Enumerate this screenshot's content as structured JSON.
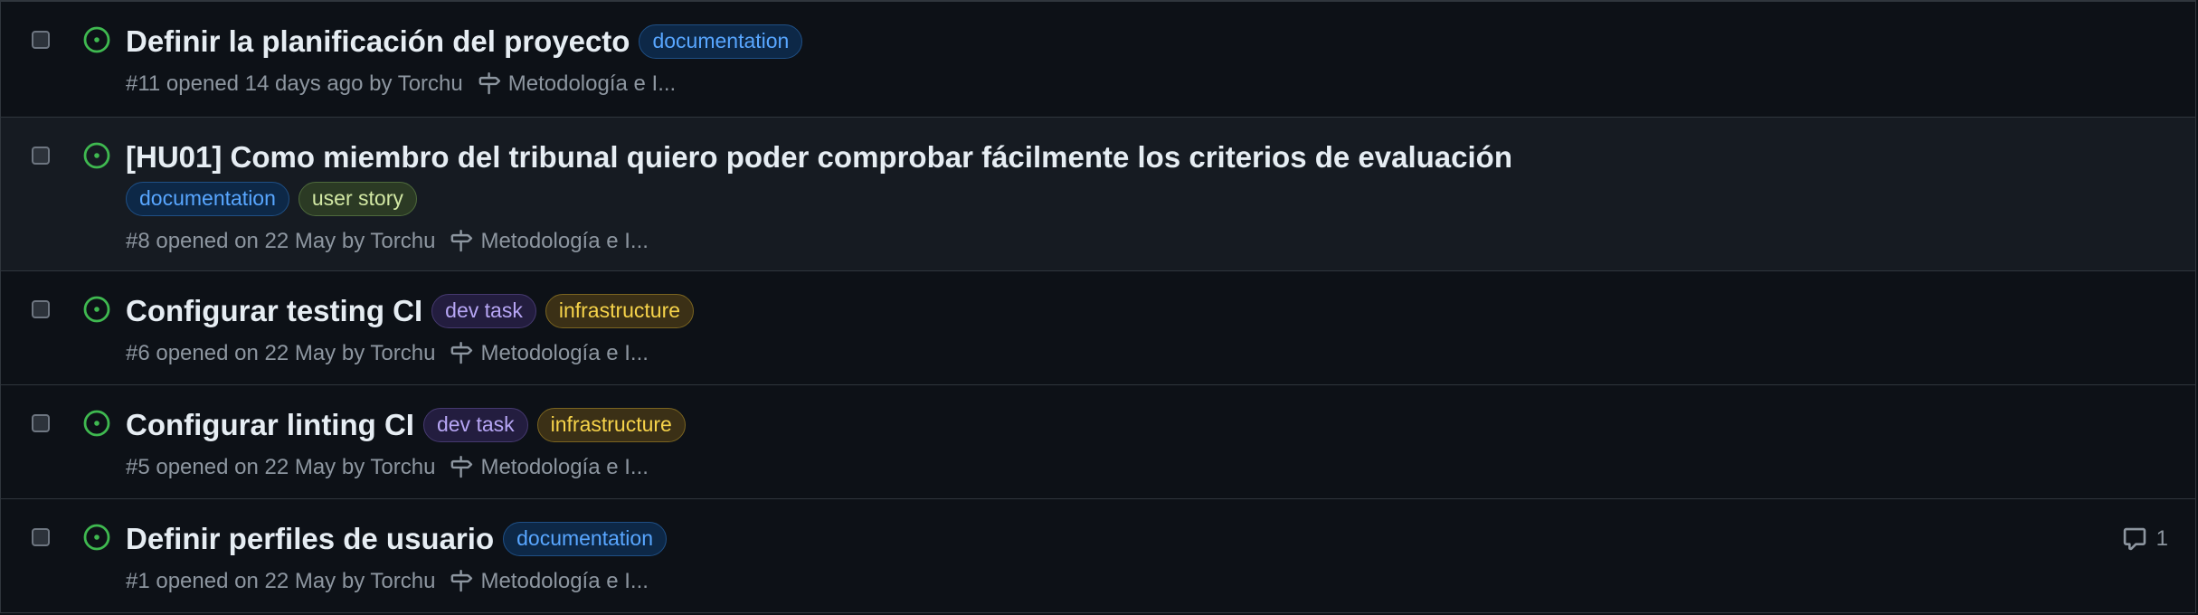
{
  "label_styles": {
    "documentation": {
      "color": "#58a6ff",
      "bg": "#0d2847",
      "border": "#1f4f85"
    },
    "user story": {
      "color": "#d2e8a4",
      "bg": "#2b3a24",
      "border": "#4e6a3c"
    },
    "dev task": {
      "color": "#b7a6f5",
      "bg": "#231d3f",
      "border": "#45396f"
    },
    "infrastructure": {
      "color": "#f6d34a",
      "bg": "#3b3016",
      "border": "#7a6420"
    }
  },
  "colors": {
    "open_icon": "#3fb950"
  },
  "issues": [
    {
      "title": "Definir la planificación del proyecto",
      "labels": [
        "documentation"
      ],
      "meta": "#11 opened 14 days ago by Torchu",
      "milestone": "Metodología e I...",
      "icon": "issue-opened-icon"
    },
    {
      "title": "[HU01] Como miembro del tribunal quiero poder comprobar fácilmente los criterios de evaluación",
      "labels": [
        "documentation",
        "user story"
      ],
      "meta": "#8 opened on 22 May by Torchu",
      "milestone": "Metodología e I...",
      "icon": "issue-opened-icon"
    },
    {
      "title": "Configurar testing CI",
      "labels": [
        "dev task",
        "infrastructure"
      ],
      "meta": "#6 opened on 22 May by Torchu",
      "milestone": "Metodología e I...",
      "icon": "issue-opened-icon"
    },
    {
      "title": "Configurar linting CI",
      "labels": [
        "dev task",
        "infrastructure"
      ],
      "meta": "#5 opened on 22 May by Torchu",
      "milestone": "Metodología e I...",
      "icon": "issue-opened-icon"
    },
    {
      "title": "Definir perfiles de usuario",
      "labels": [
        "documentation"
      ],
      "meta": "#1 opened on 22 May by Torchu",
      "milestone": "Metodología e I...",
      "icon": "issue-opened-icon",
      "comments": "1"
    }
  ]
}
